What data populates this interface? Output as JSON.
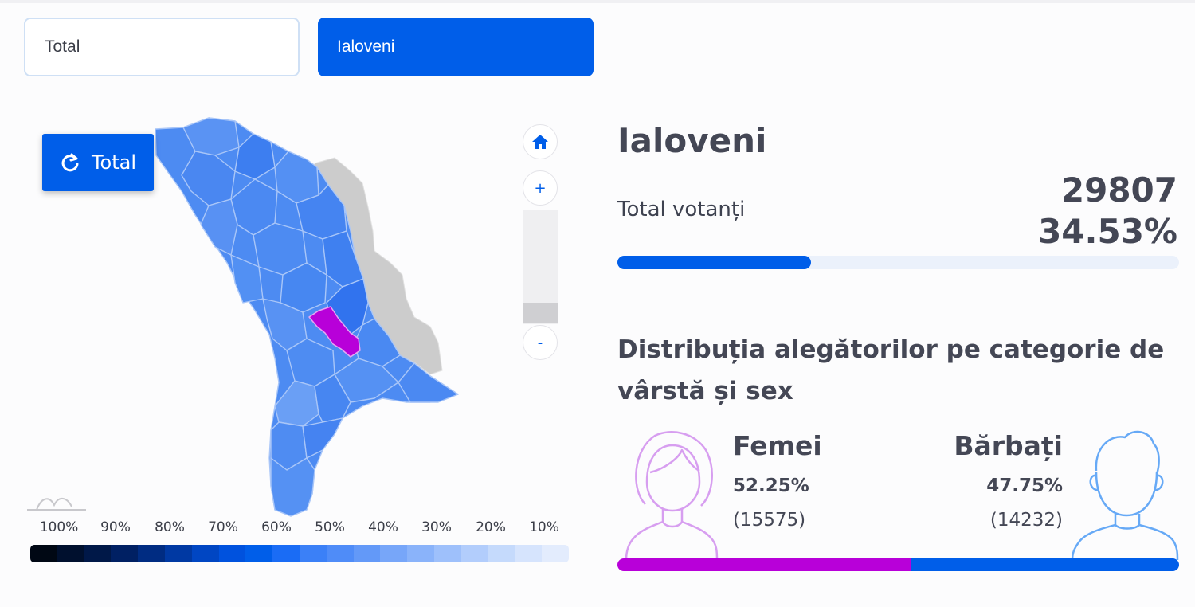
{
  "filters": {
    "total_label": "Total",
    "district_label": "Ialoveni"
  },
  "map": {
    "reset_button_label": "Total",
    "zoom_in_label": "+",
    "zoom_out_label": "-",
    "home_icon": "home-icon",
    "highlighted_region": "Ialoveni",
    "colors": {
      "region_fill": "#4d8bf2",
      "region_fill_alt": "#5a93f3",
      "region_fill_dark": "#3d7ef0",
      "selected_fill": "#b800d9",
      "no_data_fill": "#cccccc",
      "border": "#a9c6f8"
    }
  },
  "legend": {
    "labels": [
      "100%",
      "90%",
      "80%",
      "70%",
      "60%",
      "50%",
      "40%",
      "30%",
      "20%",
      "10%"
    ],
    "colors": [
      "#000814",
      "#00102e",
      "#001848",
      "#002063",
      "#002c82",
      "#0039a3",
      "#0046c3",
      "#0052de",
      "#005ee9",
      "#1a6cf5",
      "#3b80f7",
      "#4f8cf8",
      "#6399f8",
      "#77a6f9",
      "#8ab3fa",
      "#9ec0fb",
      "#b2cdfc",
      "#c5dafc",
      "#d6e4fd",
      "#e3ecfd"
    ]
  },
  "summary": {
    "district_name": "Ialoveni",
    "total_voters_label": "Total votanți",
    "total_voters": "29807",
    "turnout_pct_text": "34.53%",
    "turnout_pct": 34.53
  },
  "distribution": {
    "title": "Distribuția alegătorilor pe categorie de vârstă și sex",
    "women": {
      "label": "Femei",
      "pct_text": "52.25%",
      "count_text": "(15575)",
      "pct": 52.25
    },
    "men": {
      "label": "Bărbați",
      "pct_text": "47.75%",
      "count_text": "(14232)",
      "pct": 47.75
    },
    "colors": {
      "women": "#b800d9",
      "men": "#005ee9",
      "women_icon": "#d79ef0",
      "men_icon": "#66a9f6"
    }
  }
}
